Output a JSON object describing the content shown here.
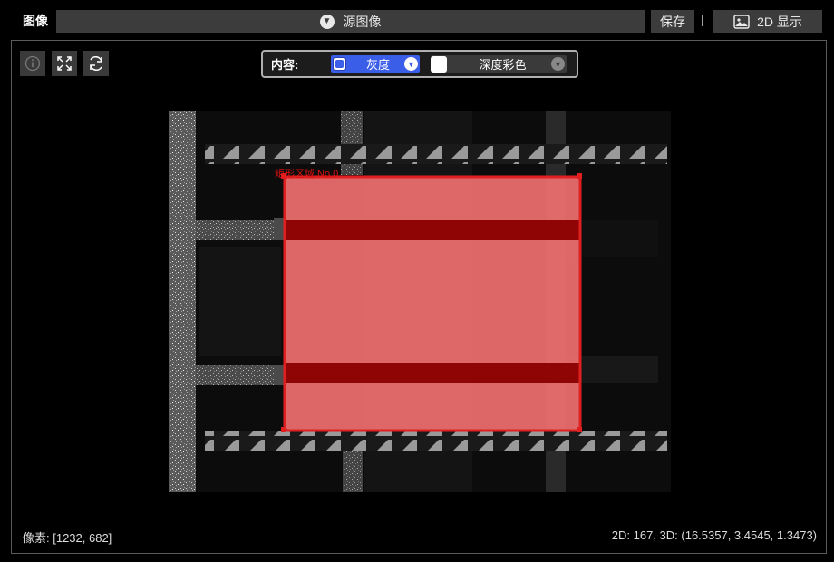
{
  "header": {
    "title": "图像",
    "source_label": "源图像",
    "save_label": "保存",
    "separator": "|",
    "show2d_label": "2D 显示"
  },
  "toolbar": {
    "info_icon": "info-icon",
    "fit_icon": "fit-view-icon",
    "reset_icon": "refresh-icon"
  },
  "content_selector": {
    "label": "内容:",
    "options": [
      {
        "label": "灰度",
        "checked": true
      },
      {
        "label": "深度彩色",
        "checked": false
      }
    ]
  },
  "roi": {
    "label": "矩形区域 No.0",
    "color": "#e02020"
  },
  "status": {
    "pixel": "像素: [1232, 682]",
    "values": "2D: 167, 3D: (16.5357, 3.4545, 1.3473)"
  },
  "colors": {
    "accent": "#3b5ee8",
    "panel": "#3c3c3c",
    "roi_fill": "#f07070",
    "roi_band": "#8a0000"
  }
}
